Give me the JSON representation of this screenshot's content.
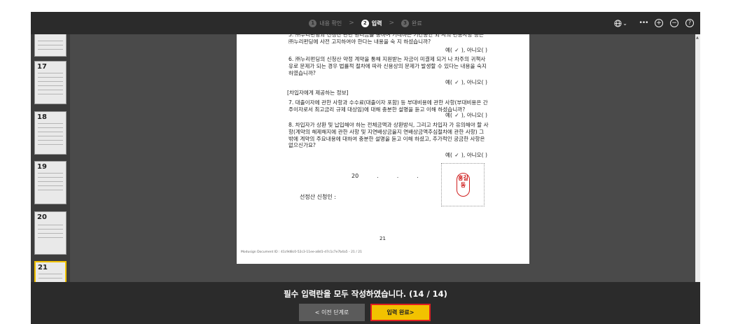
{
  "header": {
    "steps": [
      {
        "number": "1",
        "label": "내용 확인"
      },
      {
        "number": "2",
        "label": "입력"
      },
      {
        "number": "3",
        "label": "완료"
      }
    ],
    "separator": ">",
    "active_step": 1
  },
  "toolbar": {
    "language_icon": "globe-icon",
    "caret": "⌄",
    "more": "•••",
    "zoom_in": "+",
    "zoom_out": "−",
    "help": "?"
  },
  "sidebar": {
    "pages": [
      {
        "number": "",
        "selected": false
      },
      {
        "number": "17",
        "selected": false
      },
      {
        "number": "18",
        "selected": false
      },
      {
        "number": "19",
        "selected": false
      },
      {
        "number": "20",
        "selected": false
      },
      {
        "number": "21",
        "selected": true
      }
    ]
  },
  "document": {
    "q5": "5. ㈜누리펀딩과 신청산 관련 원리금을 통하여 거래하는 기간동안 외 사의 변동사항 등은 ㈜누리펀딩에 사전 고지하여야 한다는 내용을 숙 지 하셨습니까?",
    "q6": "6. ㈜누리펀딩의 신청산 약정 계약을 통해 지원받는 자금이 미결제 되거 나 차주의 귀책사유로 문제가 되는 경우 법률적 절차에 따라 신용상의 문제가 발생할 수 있다는 내용을 숙지하였습니까?",
    "section": "[차입자에게 제공하는 정보]",
    "q7": "7. 대출이자에 관한 사항과 수수료(대출이자 포함) 등 부대비용에 관한 사항(부대비용은 간주이자로서 최고금리 규제 대상임)에 대해 충분한 설명을 듣고 이해 하셨습니까?",
    "q8": "8. 차입자가 상환 및 납입해야 하는 전체금액과 상환방식, 그리고 차입자 가 유의해야 할 사항(계약의 해제해지에 관한 사항 및 지연배상금율지 연배상금액추심절차에 관한 사항) 그밖에 계약의 주요내용에 대하여 충분한 설명을 듣고 이해 하셨고, 추가적인 궁금한 사항은 없으신가요?",
    "yes_prefix": "예(",
    "check": "✓",
    "no_suffix": "), 아니오(        )",
    "date": [
      "20",
      ".",
      ".",
      "."
    ],
    "applicant_label": "선정산 신청인 :",
    "seal_text": "홍길동",
    "page_number": "21",
    "doc_id": "Modusign Document ID : 41c9d8c0-52c3-11ee-a8d1-d7c1c7e7b4a5 - 21 / 21"
  },
  "footer": {
    "status": "필수 입력란을 모두 작성하였습니다. (14 / 14)",
    "prev_button": "< 이전 단계로",
    "done_button": "입력 완료>"
  },
  "colors": {
    "accent": "#f2c200",
    "highlight_border": "#e02020",
    "seal": "#d02020"
  }
}
